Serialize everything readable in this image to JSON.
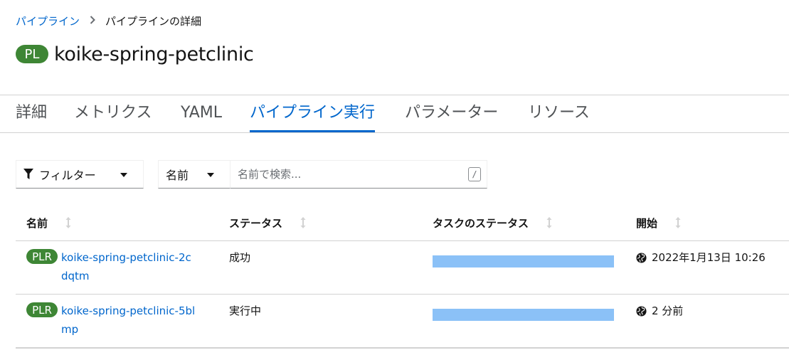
{
  "breadcrumb": {
    "parent": "パイプライン",
    "current": "パイプラインの詳細"
  },
  "header": {
    "badge": "PL",
    "title": "koike-spring-petclinic"
  },
  "tabs": [
    {
      "label": "詳細",
      "active": false
    },
    {
      "label": "メトリクス",
      "active": false
    },
    {
      "label": "YAML",
      "active": false
    },
    {
      "label": "パイプライン実行",
      "active": true
    },
    {
      "label": "パラメーター",
      "active": false
    },
    {
      "label": "リソース",
      "active": false
    }
  ],
  "toolbar": {
    "filter_label": "フィルター",
    "filter_icon": "filter-icon",
    "attribute_selected": "名前",
    "search_placeholder": "名前で検索...",
    "search_value": "",
    "search_shortcut": "/"
  },
  "table": {
    "columns": [
      "名前",
      "ステータス",
      "タスクのステータス",
      "開始"
    ],
    "rows": [
      {
        "badge": "PLR",
        "name": "koike-spring-petclinic-2cdqtm",
        "status": "成功",
        "task_progress": 1.0,
        "started": "2022年1月13日 10:26",
        "started_icon": "globe-icon"
      },
      {
        "badge": "PLR",
        "name": "koike-spring-petclinic-5blmp",
        "status": "実行中",
        "task_progress": 1.0,
        "started": "2 分前",
        "started_icon": "globe-icon"
      }
    ]
  },
  "colors": {
    "accent": "#0066cc",
    "badge_green": "#3e8635",
    "task_bar": "#8bc1f7",
    "border": "#d2d2d2"
  }
}
